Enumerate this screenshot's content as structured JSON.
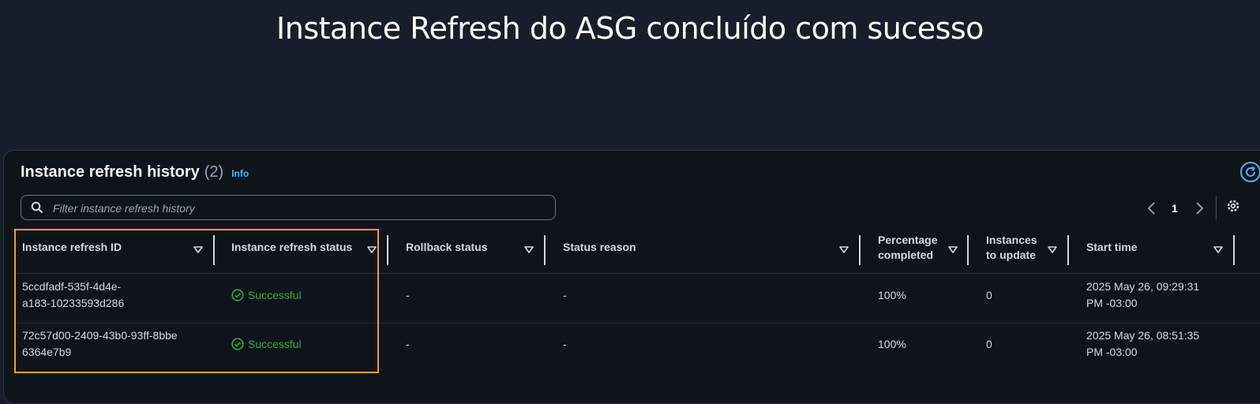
{
  "banner": {
    "title": "Instance Refresh do ASG concluído com sucesso"
  },
  "panel": {
    "title": "Instance refresh history",
    "count": "(2)",
    "info": "Info"
  },
  "search": {
    "placeholder": "Filter instance refresh history",
    "value": ""
  },
  "pagination": {
    "current_page": "1"
  },
  "table": {
    "columns": [
      {
        "line1": "Instance refresh ID",
        "line2": ""
      },
      {
        "line1": "Instance refresh status",
        "line2": ""
      },
      {
        "line1": "Rollback status",
        "line2": ""
      },
      {
        "line1": "Status reason",
        "line2": ""
      },
      {
        "line1": "Percentage",
        "line2": "completed"
      },
      {
        "line1": "Instances",
        "line2": "to update"
      },
      {
        "line1": "Start time",
        "line2": ""
      }
    ],
    "rows": [
      {
        "id_line1": "5ccdfadf-535f-4d4e-",
        "id_line2": "a183-10233593d286",
        "status": "Successful",
        "rollback": "-",
        "reason": "-",
        "percentage": "100%",
        "instances": "0",
        "start_line1": "2025 May 26, 09:29:31",
        "start_line2": "PM -03:00"
      },
      {
        "id_line1": "72c57d00-2409-43b0-93ff-8bbe",
        "id_line2": "6364e7b9",
        "status": "Successful",
        "rollback": "-",
        "reason": "-",
        "percentage": "100%",
        "instances": "0",
        "start_line1": "2025 May 26, 08:51:35",
        "start_line2": "PM -03:00"
      }
    ]
  },
  "colors": {
    "accent": "#4db3f5",
    "success": "#29ad32",
    "highlight": "#f29e1e",
    "background": "#181e29",
    "panel": "#0f141b"
  },
  "icons": {
    "refresh": "refresh-icon",
    "search": "search-icon",
    "prev": "chevron-left-icon",
    "next": "chevron-right-icon",
    "settings": "gear-icon",
    "filter": "filter-triangle-icon",
    "status": "check-circle-icon"
  }
}
